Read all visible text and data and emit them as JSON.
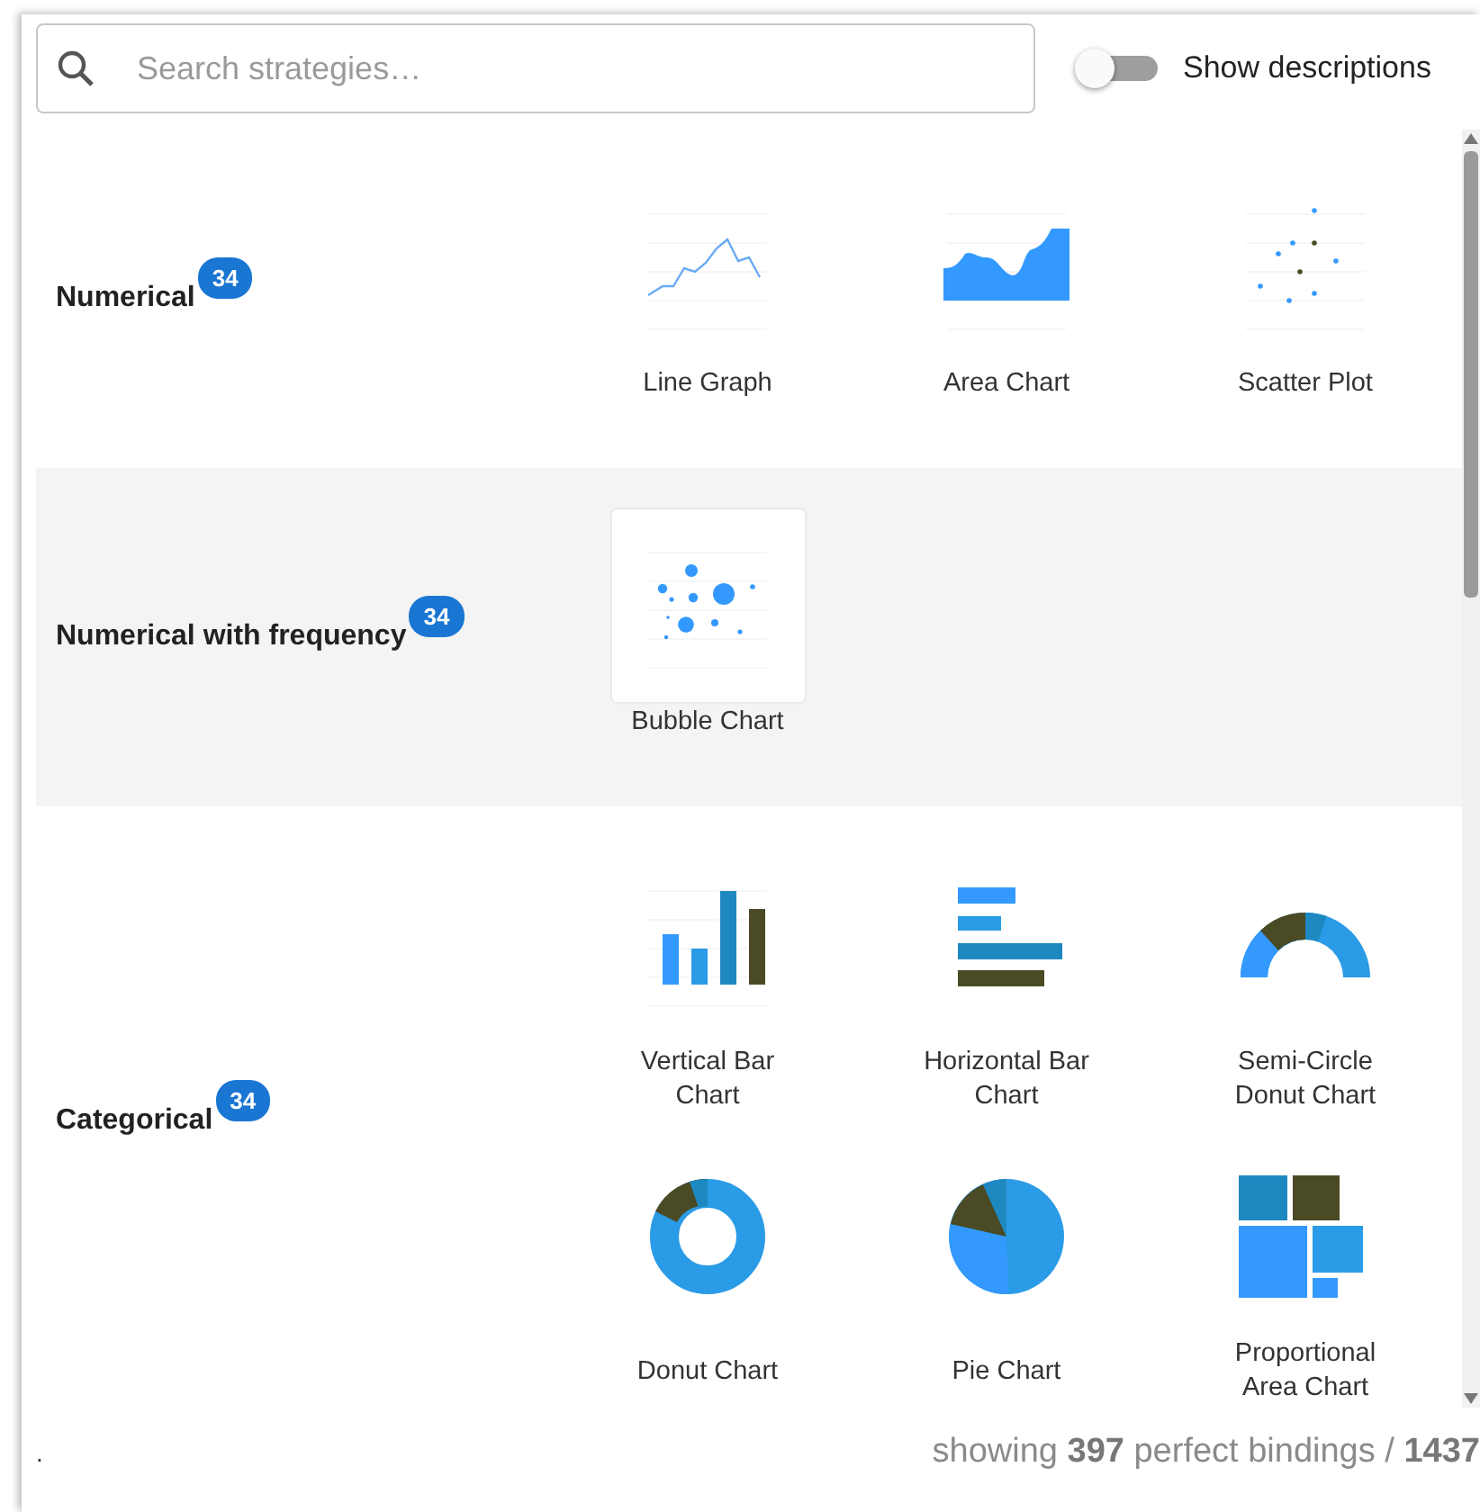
{
  "search": {
    "placeholder": "Search strategies…"
  },
  "toggle": {
    "label": "Show descriptions",
    "on": false
  },
  "groups": [
    {
      "name": "Numerical",
      "count": "34",
      "tiles": [
        {
          "kind": "line",
          "label": "Line Graph",
          "selected": false
        },
        {
          "kind": "area",
          "label": "Area Chart",
          "selected": false
        },
        {
          "kind": "scatter",
          "label": "Scatter Plot",
          "selected": false
        }
      ]
    },
    {
      "name": "Numerical with frequency",
      "count": "34",
      "tiles": [
        {
          "kind": "bubble",
          "label": "Bubble Chart",
          "selected": true
        }
      ]
    },
    {
      "name": "Categorical",
      "count": "34",
      "tiles": [
        {
          "kind": "vbar",
          "label": "Vertical Bar Chart",
          "selected": false
        },
        {
          "kind": "hbar",
          "label": "Horizontal Bar Chart",
          "selected": false
        },
        {
          "kind": "semidonut",
          "label": "Semi-Circle Donut Chart",
          "selected": false
        },
        {
          "kind": "donut",
          "label": "Donut Chart",
          "selected": false
        },
        {
          "kind": "pie",
          "label": "Pie Chart",
          "selected": false
        },
        {
          "kind": "treemap",
          "label": "Proportional Area Chart",
          "selected": false
        }
      ]
    }
  ],
  "footer": {
    "mark": ".",
    "summary": "showing **397** perfect bindings / **1437**"
  }
}
